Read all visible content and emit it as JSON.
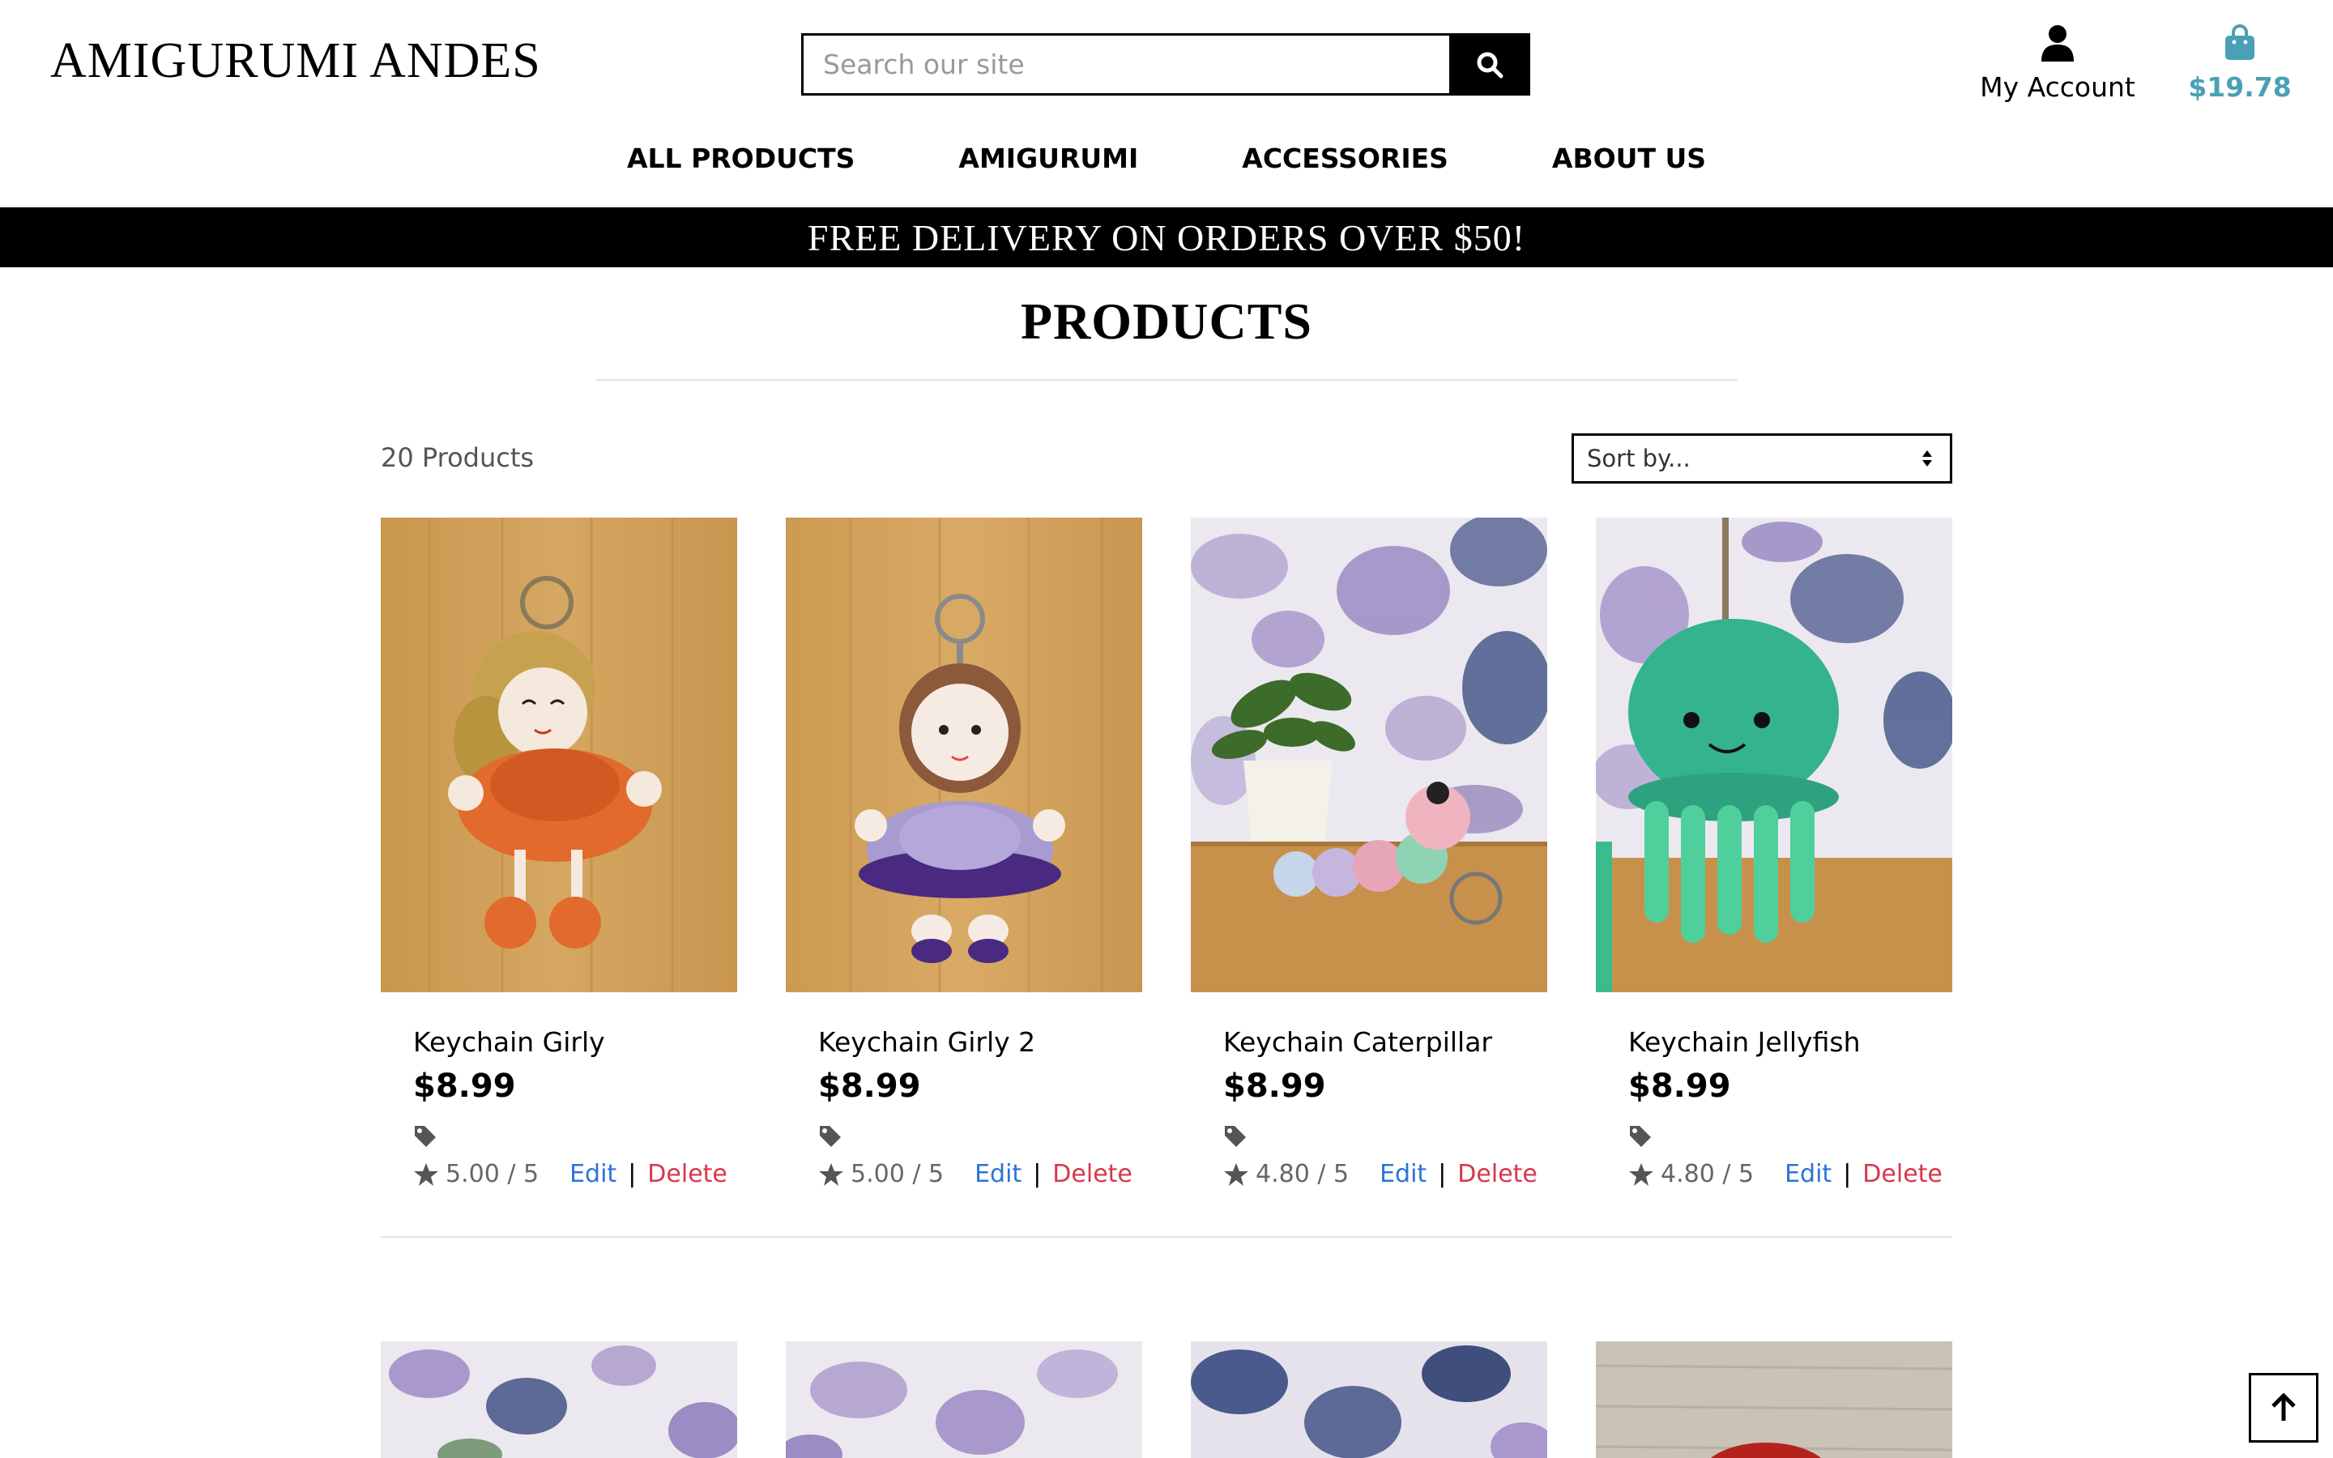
{
  "header": {
    "logo": "AMIGURUMI ANDES",
    "search_placeholder": "Search our site",
    "account_label": "My Account",
    "bag_total": "$19.78",
    "accent_color": "#4aa0b5"
  },
  "nav": {
    "items": [
      "ALL PRODUCTS",
      "AMIGURUMI",
      "ACCESSORIES",
      "ABOUT US"
    ]
  },
  "banner": {
    "text": "FREE DELIVERY ON ORDERS OVER $50!"
  },
  "main": {
    "title": "PRODUCTS",
    "count": "20 Products",
    "sort_label": "Sort by...",
    "edit_label": "Edit",
    "delete_label": "Delete",
    "separator": "|",
    "products": [
      {
        "name": "Keychain Girly",
        "price": "$8.99",
        "rating": "5.00 / 5"
      },
      {
        "name": "Keychain Girly 2",
        "price": "$8.99",
        "rating": "5.00 / 5"
      },
      {
        "name": "Keychain Caterpillar",
        "price": "$8.99",
        "rating": "4.80 / 5"
      },
      {
        "name": "Keychain Jellyfish",
        "price": "$8.99",
        "rating": "4.80 / 5"
      }
    ]
  },
  "icons": [
    "search-icon",
    "user-icon",
    "shopping-bag-icon",
    "tag-icon",
    "star-icon",
    "sort-arrows-icon",
    "arrow-up-icon"
  ],
  "colors": {
    "edit_link": "#2a74d8",
    "delete_link": "#d9364a",
    "banner_bg": "#000000"
  }
}
